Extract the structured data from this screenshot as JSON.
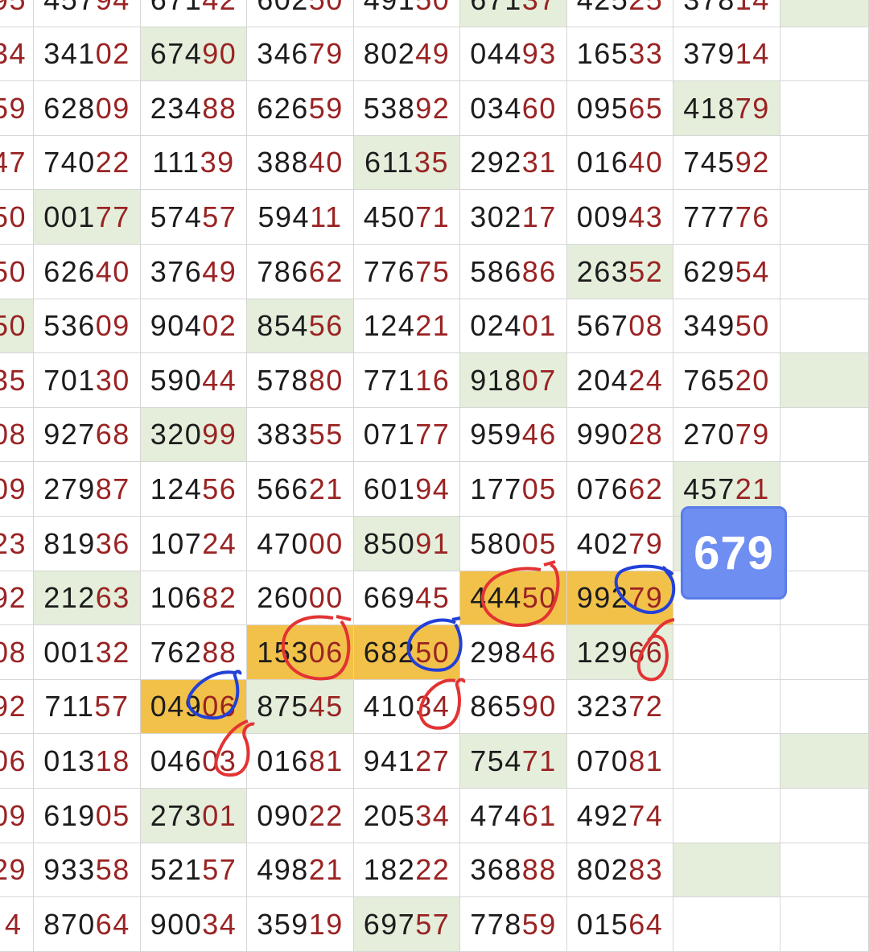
{
  "badge": {
    "label": "679"
  },
  "colors": {
    "highlight_green": "#e4eedb",
    "highlight_orange": "#f2c14a",
    "digit_red": "#9a2323",
    "badge_blue": "#6f8ef1",
    "ink_red": "#e33333",
    "ink_blue": "#2340d8"
  },
  "rows": [
    {
      "first": "95",
      "cells": [
        {
          "v": "45794"
        },
        {
          "v": "67142"
        },
        {
          "v": "60250"
        },
        {
          "v": "49150"
        },
        {
          "v": "67137",
          "bg": "green"
        },
        {
          "v": "42525"
        },
        {
          "v": "37814"
        },
        {
          "v": "",
          "bg": "green"
        }
      ]
    },
    {
      "first": "34",
      "cells": [
        {
          "v": "34102"
        },
        {
          "v": "67490",
          "bg": "green"
        },
        {
          "v": "34679"
        },
        {
          "v": "80249"
        },
        {
          "v": "04493"
        },
        {
          "v": "16533"
        },
        {
          "v": "37914"
        },
        {
          "v": ""
        }
      ]
    },
    {
      "first": "59",
      "cells": [
        {
          "v": "62809"
        },
        {
          "v": "23488"
        },
        {
          "v": "62659"
        },
        {
          "v": "53892"
        },
        {
          "v": "03460"
        },
        {
          "v": "09565"
        },
        {
          "v": "41879",
          "bg": "green"
        },
        {
          "v": ""
        }
      ]
    },
    {
      "first": "47",
      "cells": [
        {
          "v": "74022"
        },
        {
          "v": "11139"
        },
        {
          "v": "38840"
        },
        {
          "v": "61135",
          "bg": "green"
        },
        {
          "v": "29231"
        },
        {
          "v": "01640"
        },
        {
          "v": "74592"
        },
        {
          "v": ""
        }
      ]
    },
    {
      "first": "50",
      "cells": [
        {
          "v": "00177",
          "bg": "green"
        },
        {
          "v": "57457"
        },
        {
          "v": "59411"
        },
        {
          "v": "45071"
        },
        {
          "v": "30217"
        },
        {
          "v": "00943"
        },
        {
          "v": "77776"
        },
        {
          "v": ""
        }
      ]
    },
    {
      "first": "50",
      "cells": [
        {
          "v": "62640"
        },
        {
          "v": "37649"
        },
        {
          "v": "78662"
        },
        {
          "v": "77675"
        },
        {
          "v": "58686"
        },
        {
          "v": "26352",
          "bg": "green"
        },
        {
          "v": "62954"
        },
        {
          "v": ""
        }
      ]
    },
    {
      "first": "50",
      "firstbg": "green",
      "cells": [
        {
          "v": "53609"
        },
        {
          "v": "90402"
        },
        {
          "v": "85456",
          "bg": "green"
        },
        {
          "v": "12421"
        },
        {
          "v": "02401"
        },
        {
          "v": "56708"
        },
        {
          "v": "34950"
        },
        {
          "v": ""
        }
      ]
    },
    {
      "first": "35",
      "cells": [
        {
          "v": "70130"
        },
        {
          "v": "59044"
        },
        {
          "v": "57880"
        },
        {
          "v": "77116"
        },
        {
          "v": "91807",
          "bg": "green"
        },
        {
          "v": "20424"
        },
        {
          "v": "76520"
        },
        {
          "v": "",
          "bg": "green"
        }
      ]
    },
    {
      "first": "08",
      "cells": [
        {
          "v": "92768"
        },
        {
          "v": "32099",
          "bg": "green"
        },
        {
          "v": "38355"
        },
        {
          "v": "07177"
        },
        {
          "v": "95946"
        },
        {
          "v": "99028"
        },
        {
          "v": "27079"
        },
        {
          "v": ""
        }
      ]
    },
    {
      "first": "09",
      "cells": [
        {
          "v": "27987"
        },
        {
          "v": "12456"
        },
        {
          "v": "56621"
        },
        {
          "v": "60194"
        },
        {
          "v": "17705"
        },
        {
          "v": "07662"
        },
        {
          "v": "45721",
          "bg": "green"
        },
        {
          "v": ""
        }
      ]
    },
    {
      "first": "23",
      "cells": [
        {
          "v": "81936"
        },
        {
          "v": "10724"
        },
        {
          "v": "47000"
        },
        {
          "v": "85091",
          "bg": "green"
        },
        {
          "v": "58005"
        },
        {
          "v": "40279"
        },
        {
          "v": "",
          "bg": "green"
        },
        {
          "v": ""
        }
      ]
    },
    {
      "first": "92",
      "cells": [
        {
          "v": "21263",
          "bg": "green"
        },
        {
          "v": "10682"
        },
        {
          "v": "26000"
        },
        {
          "v": "66945"
        },
        {
          "v": "44450",
          "bg": "orange"
        },
        {
          "v": "99279",
          "bg": "orange"
        },
        {
          "v": ""
        },
        {
          "v": ""
        }
      ]
    },
    {
      "first": "08",
      "cells": [
        {
          "v": "00132"
        },
        {
          "v": "76288"
        },
        {
          "v": "15306",
          "bg": "orange"
        },
        {
          "v": "68250",
          "bg": "orange"
        },
        {
          "v": "29846"
        },
        {
          "v": "12966",
          "bg": "green"
        },
        {
          "v": ""
        },
        {
          "v": ""
        }
      ]
    },
    {
      "first": "92",
      "cells": [
        {
          "v": "71157"
        },
        {
          "v": "04906",
          "bg": "orange"
        },
        {
          "v": "87545",
          "bg": "green"
        },
        {
          "v": "41034"
        },
        {
          "v": "86590"
        },
        {
          "v": "32372"
        },
        {
          "v": ""
        },
        {
          "v": ""
        }
      ]
    },
    {
      "first": "06",
      "cells": [
        {
          "v": "01318"
        },
        {
          "v": "04603"
        },
        {
          "v": "01681"
        },
        {
          "v": "94127"
        },
        {
          "v": "75471",
          "bg": "green"
        },
        {
          "v": "07081"
        },
        {
          "v": ""
        },
        {
          "v": "",
          "bg": "green"
        }
      ]
    },
    {
      "first": "09",
      "cells": [
        {
          "v": "61905"
        },
        {
          "v": "27301",
          "bg": "green"
        },
        {
          "v": "09022"
        },
        {
          "v": "20534"
        },
        {
          "v": "47461"
        },
        {
          "v": "49274"
        },
        {
          "v": ""
        },
        {
          "v": ""
        }
      ]
    },
    {
      "first": "29",
      "cells": [
        {
          "v": "93358"
        },
        {
          "v": "52157"
        },
        {
          "v": "49821"
        },
        {
          "v": "18222"
        },
        {
          "v": "36888"
        },
        {
          "v": "80283"
        },
        {
          "v": "",
          "bg": "green"
        },
        {
          "v": ""
        }
      ]
    },
    {
      "first": "4",
      "cells": [
        {
          "v": "87064"
        },
        {
          "v": "90034"
        },
        {
          "v": "35919"
        },
        {
          "v": "69757",
          "bg": "green"
        },
        {
          "v": "77859"
        },
        {
          "v": "01564"
        },
        {
          "v": ""
        },
        {
          "v": ""
        }
      ]
    }
  ]
}
